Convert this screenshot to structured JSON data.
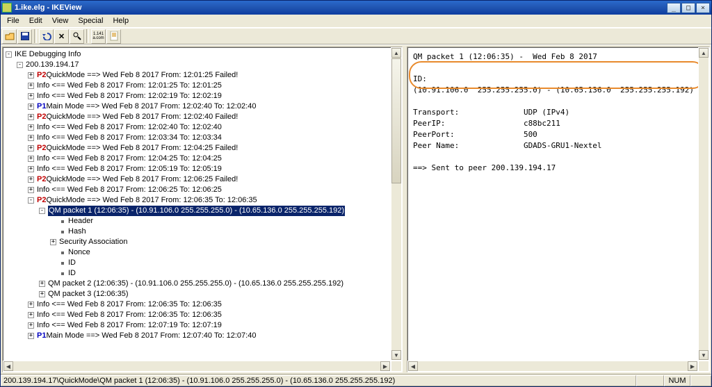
{
  "title_icon": "ikeview-file-icon",
  "title": "1.ike.elg - IKEView",
  "menu": {
    "file": "File",
    "edit": "Edit",
    "view": "View",
    "special": "Special",
    "help": "Help"
  },
  "toolbar": {
    "open": "open-icon",
    "save": "save-icon",
    "undo": "undo-icon",
    "delete": "delete-icon",
    "find": "find-icon",
    "text": "1.141\na.com",
    "doc": "doc-icon"
  },
  "tree": {
    "root": "IKE Debugging Info",
    "host": "200.139.194.17",
    "items": [
      {
        "tag": "P2",
        "label": "QuickMode  ==> Wed Feb 8 2017 From: 12:01:25 Failed!"
      },
      {
        "tag": "",
        "label": "Info  <== Wed Feb 8 2017 From: 12:01:25 To: 12:01:25"
      },
      {
        "tag": "",
        "label": "Info  <== Wed Feb 8 2017 From: 12:02:19 To: 12:02:19"
      },
      {
        "tag": "P1",
        "label": "Main Mode  ==> Wed Feb 8 2017 From: 12:02:40 To: 12:02:40"
      },
      {
        "tag": "P2",
        "label": "QuickMode  ==> Wed Feb 8 2017 From: 12:02:40 Failed!"
      },
      {
        "tag": "",
        "label": "Info  <== Wed Feb 8 2017 From: 12:02:40 To: 12:02:40"
      },
      {
        "tag": "",
        "label": "Info  <== Wed Feb 8 2017 From: 12:03:34 To: 12:03:34"
      },
      {
        "tag": "P2",
        "label": "QuickMode  ==> Wed Feb 8 2017 From: 12:04:25 Failed!"
      },
      {
        "tag": "",
        "label": "Info  <== Wed Feb 8 2017 From: 12:04:25 To: 12:04:25"
      },
      {
        "tag": "",
        "label": "Info  <== Wed Feb 8 2017 From: 12:05:19 To: 12:05:19"
      },
      {
        "tag": "P2",
        "label": "QuickMode  ==> Wed Feb 8 2017 From: 12:06:25 Failed!"
      },
      {
        "tag": "",
        "label": "Info  <== Wed Feb 8 2017 From: 12:06:25 To: 12:06:25"
      }
    ],
    "open": {
      "tag": "P2",
      "label": "QuickMode  ==> Wed Feb 8 2017 From: 12:06:35 To: 12:06:35",
      "sel": "QM packet 1 (12:06:35) - (10.91.106.0  255.255.255.0) - (10.65.136.0  255.255.255.192)",
      "kids": [
        "Header",
        "Hash",
        "Security Association",
        "Nonce",
        "ID",
        "ID"
      ],
      "siblings": [
        "QM packet 2 (12:06:35) - (10.91.106.0  255.255.255.0) - (10.65.136.0  255.255.255.192)",
        "QM packet 3 (12:06:35)"
      ]
    },
    "tail": [
      {
        "tag": "",
        "label": "Info  <== Wed Feb 8 2017 From: 12:06:35 To: 12:06:35"
      },
      {
        "tag": "",
        "label": "Info  <== Wed Feb 8 2017 From: 12:06:35 To: 12:06:35"
      },
      {
        "tag": "",
        "label": "Info  <== Wed Feb 8 2017 From: 12:07:19 To: 12:07:19"
      },
      {
        "tag": "P1",
        "label": "Main Mode  ==> Wed Feb 8 2017 From: 12:07:40 To: 12:07:40"
      }
    ]
  },
  "detail": {
    "header": "QM packet 1 (12:06:35) -  Wed Feb 8 2017",
    "id_label": "ID:",
    "id_value": "(10.91.106.0  255.255.255.0) - (10.65.136.0  255.255.255.192)",
    "rows": [
      {
        "k": "Transport:",
        "v": "UDP (IPv4)"
      },
      {
        "k": "PeerIP:",
        "v": "c88bc211"
      },
      {
        "k": "PeerPort:",
        "v": "500"
      },
      {
        "k": "Peer Name:",
        "v": "GDADS-GRU1-Nextel"
      }
    ],
    "sent": "==> Sent to peer 200.139.194.17"
  },
  "status": {
    "path": "200.139.194.17\\QuickMode\\QM packet 1 (12:06:35) - (10.91.106.0  255.255.255.0) - (10.65.136.0  255.255.255.192)",
    "num": "NUM"
  }
}
